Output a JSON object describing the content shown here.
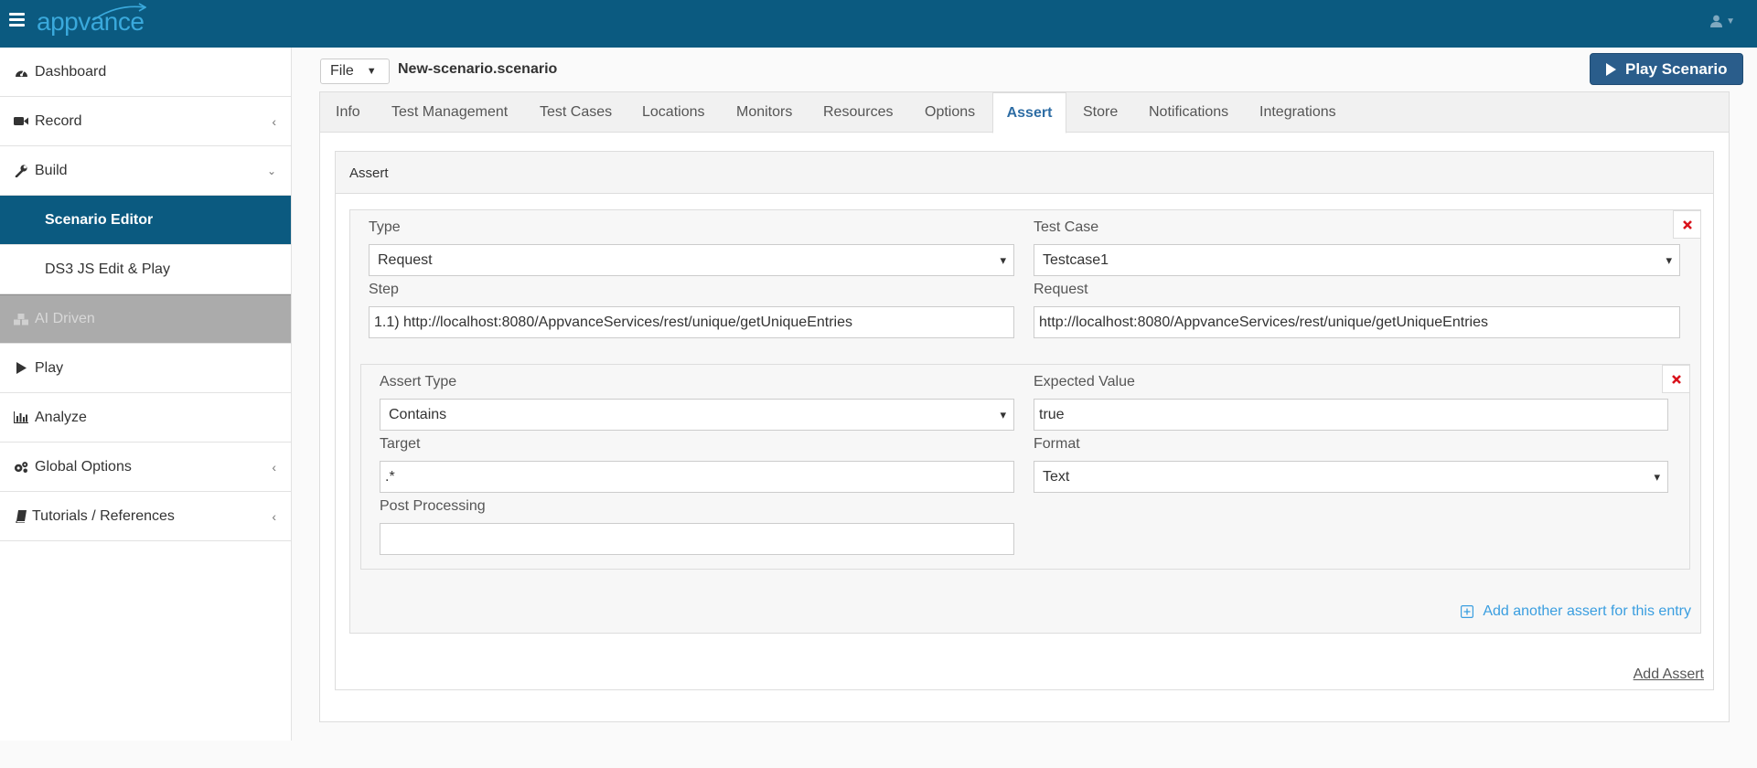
{
  "app": {
    "logo_text": "appvance"
  },
  "sidebar": {
    "items": [
      {
        "label": "Dashboard",
        "icon": "dashboard-icon"
      },
      {
        "label": "Record",
        "icon": "video-camera-icon"
      },
      {
        "label": "Build",
        "icon": "wrench-icon"
      },
      {
        "label": "Scenario Editor"
      },
      {
        "label": "DS3 JS Edit & Play"
      },
      {
        "label": "AI Driven",
        "icon": "cubes-icon"
      },
      {
        "label": "Play",
        "icon": "play-icon"
      },
      {
        "label": "Analyze",
        "icon": "bar-chart-icon"
      },
      {
        "label": "Global Options",
        "icon": "gears-icon"
      },
      {
        "label": "Tutorials / References",
        "icon": "book-icon"
      }
    ]
  },
  "header": {
    "file_label": "File",
    "scenario_name": "New-scenario.scenario",
    "play_label": "Play Scenario"
  },
  "tabs": [
    "Info",
    "Test Management",
    "Test Cases",
    "Locations",
    "Monitors",
    "Resources",
    "Options",
    "Assert",
    "Store",
    "Notifications",
    "Integrations"
  ],
  "active_tab": "Assert",
  "assert_panel": {
    "title": "Assert",
    "entry": {
      "type_label": "Type",
      "type_value": "Request",
      "testcase_label": "Test Case",
      "testcase_value": "Testcase1",
      "step_label": "Step",
      "step_value": "1.1) http://localhost:8080/AppvanceServices/rest/unique/getUniqueEntries",
      "request_label": "Request",
      "request_value": "http://localhost:8080/AppvanceServices/rest/unique/getUniqueEntries",
      "assert": {
        "assert_type_label": "Assert Type",
        "assert_type_value": "Contains",
        "expected_label": "Expected Value",
        "expected_value": "true",
        "target_label": "Target",
        "target_value": ".*",
        "format_label": "Format",
        "format_value": "Text",
        "postproc_label": "Post Processing",
        "postproc_value": ""
      },
      "add_another_label": "Add another assert for this entry"
    },
    "add_assert_label": "Add Assert"
  },
  "colors": {
    "topbar": "#0b5a80",
    "active_nav": "#0b5a80",
    "play_button": "#2a5d8b",
    "link": "#3a9ee0",
    "delete_x": "#d9121b"
  }
}
